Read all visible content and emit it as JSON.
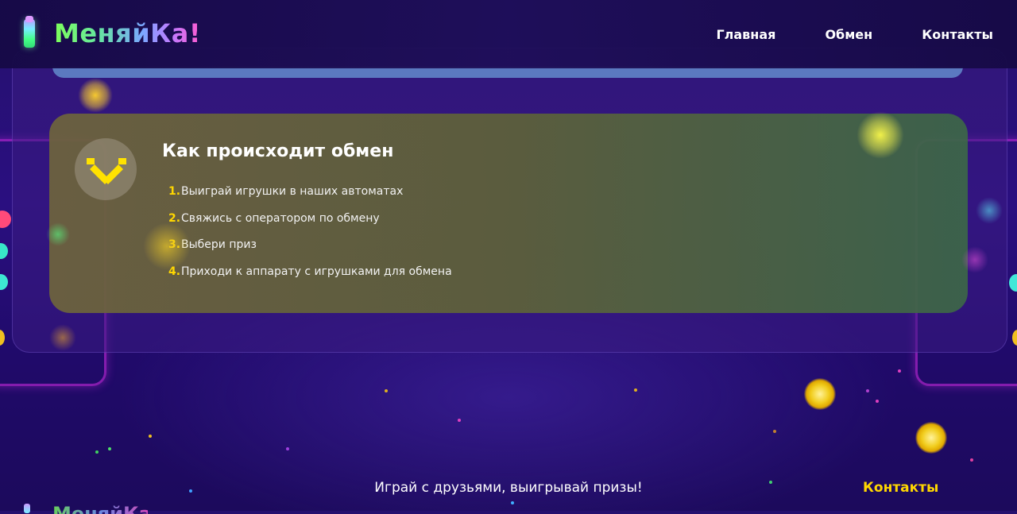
{
  "header": {
    "logo_text": "МеняйКа!",
    "nav": [
      {
        "label": "Главная"
      },
      {
        "label": "Обмен"
      },
      {
        "label": "Контакты"
      }
    ]
  },
  "exchange": {
    "title": "Как происходит обмен",
    "steps": [
      {
        "num": "1.",
        "text": "Выиграй игрушки в наших автоматах"
      },
      {
        "num": "2.",
        "text": "Свяжись с оператором по обмену"
      },
      {
        "num": "3.",
        "text": "Выбери приз"
      },
      {
        "num": "4.",
        "text": "Приходи к аппарату с игрушками для обмена"
      }
    ]
  },
  "footer": {
    "slogan": "Играй с друзьями, выигрывай призы!",
    "contacts": "Контакты"
  },
  "colors": {
    "accent": "#ffd700",
    "background": "#25106e",
    "card": "#6b6a45"
  },
  "icons": {
    "logo": "claw-toy-icon",
    "exchange": "exchange-arrows-icon"
  }
}
